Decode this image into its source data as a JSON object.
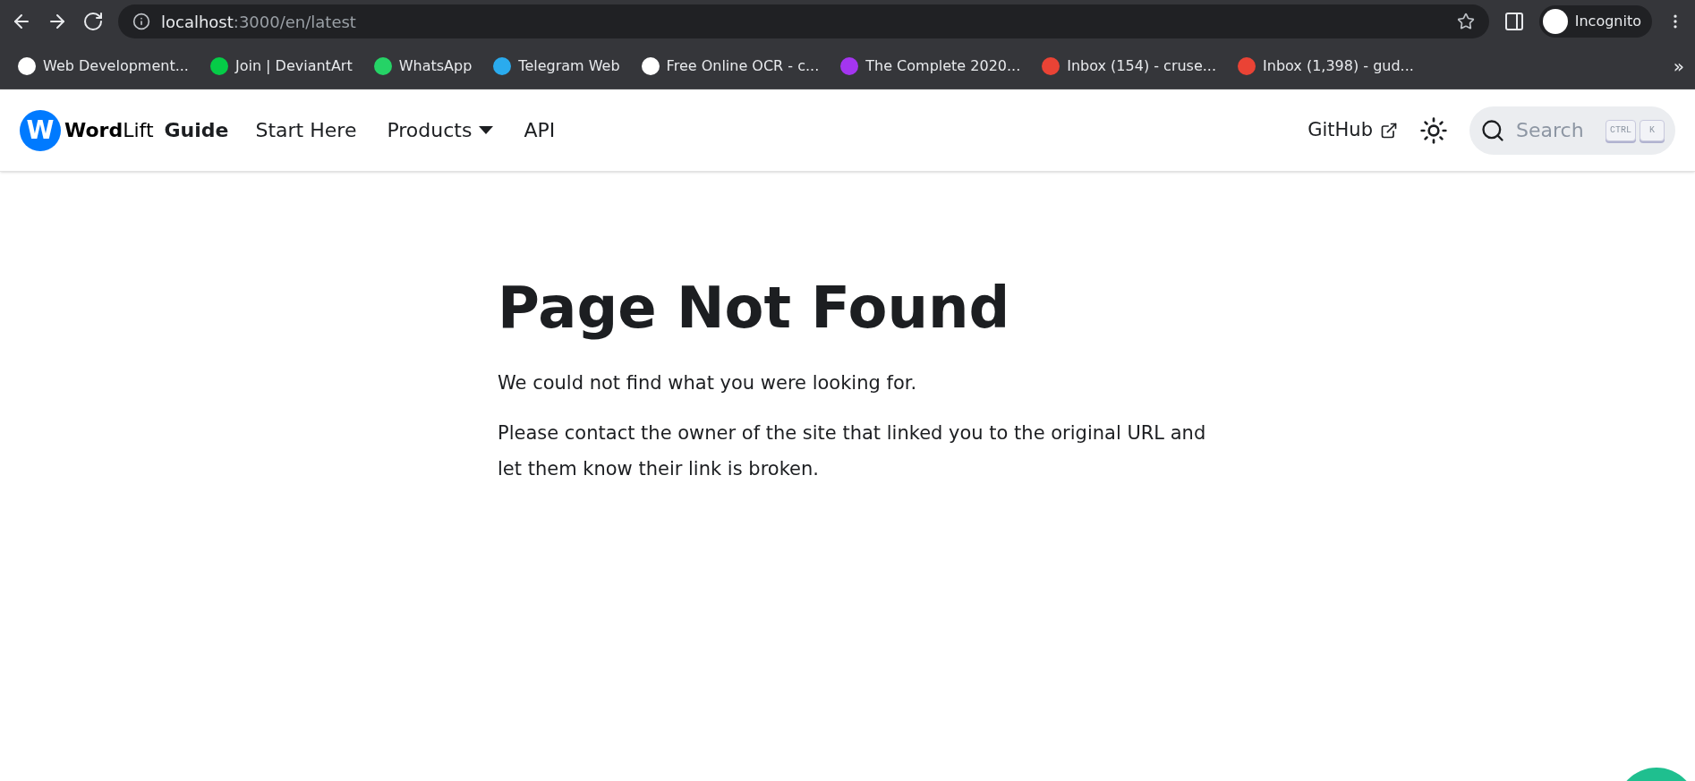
{
  "browser": {
    "url_host": "localhost",
    "url_path": ":3000/en/latest",
    "profile": "Incognito",
    "bookmarks": [
      {
        "label": "Web Development...",
        "color": "#ffffff"
      },
      {
        "label": "Join | DeviantArt",
        "color": "#05cc47"
      },
      {
        "label": "WhatsApp",
        "color": "#25d366"
      },
      {
        "label": "Telegram Web",
        "color": "#2aabee"
      },
      {
        "label": "Free Online OCR - c...",
        "color": "#ffffff"
      },
      {
        "label": "The Complete 2020...",
        "color": "#a435f0"
      },
      {
        "label": "Inbox (154) - cruse...",
        "color": "#ea4335"
      },
      {
        "label": "Inbox (1,398) - gud...",
        "color": "#ea4335"
      }
    ],
    "more": "»"
  },
  "navbar": {
    "logo_letter": "W",
    "brand": "**Word**Lift",
    "guide": "Guide",
    "links": [
      {
        "label": "Start Here",
        "kind": "link"
      },
      {
        "label": "Products",
        "kind": "dropdown"
      },
      {
        "label": "API",
        "kind": "link"
      }
    ],
    "github": "GitHub",
    "search": {
      "placeholder": "Search",
      "keys": [
        "CTRL",
        "K"
      ]
    }
  },
  "content": {
    "title": "Page Not Found",
    "paragraphs": [
      "We could not find what you were looking for.",
      "Please contact the owner of the site that linked you to the original URL and let them know their link is broken."
    ]
  }
}
